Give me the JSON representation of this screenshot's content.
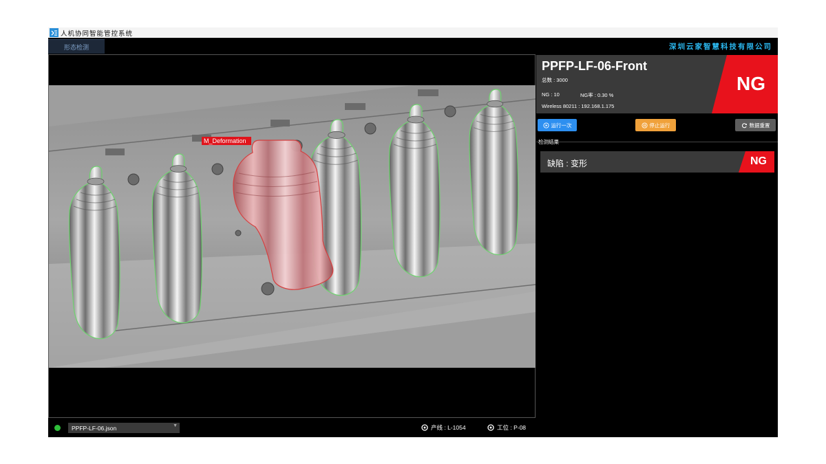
{
  "window": {
    "title": "人机协同智能管控系统"
  },
  "nav": {
    "tab_label": "形态检测",
    "company": "深圳云家智慧科技有限公司"
  },
  "camera": {
    "detection_label": "M_Deformation"
  },
  "device": {
    "name": "PPFP-LF-06-Front",
    "total": "总数 : 3000",
    "ng_count": "NG : 10",
    "ng_rate": "NG率 : 0.30 %",
    "wireless": "Wireless 80211 : 192.168.1.175",
    "status": "NG"
  },
  "buttons": {
    "run_once": "运行一次",
    "stop": "停止运行",
    "reset": "数据重置"
  },
  "results": {
    "section_title": "检测结果",
    "items": [
      {
        "text": "缺陷 : 变形",
        "status": "NG"
      }
    ]
  },
  "bottom": {
    "config_file": "PPFP-LF-06.json",
    "line": "产线 : L-1054",
    "station": "工位 : P-08"
  },
  "colors": {
    "accent_blue": "#2d8ff0",
    "accent_orange": "#f0a13a",
    "ng_red": "#e8121c",
    "ok_green": "#2fbf3a",
    "company_blue": "#2bb7ee"
  },
  "icons": {
    "app_logo": "app-logo-icon",
    "run": "play-circle-icon",
    "stop": "pause-circle-icon",
    "reset": "refresh-icon",
    "location": "target-icon"
  }
}
